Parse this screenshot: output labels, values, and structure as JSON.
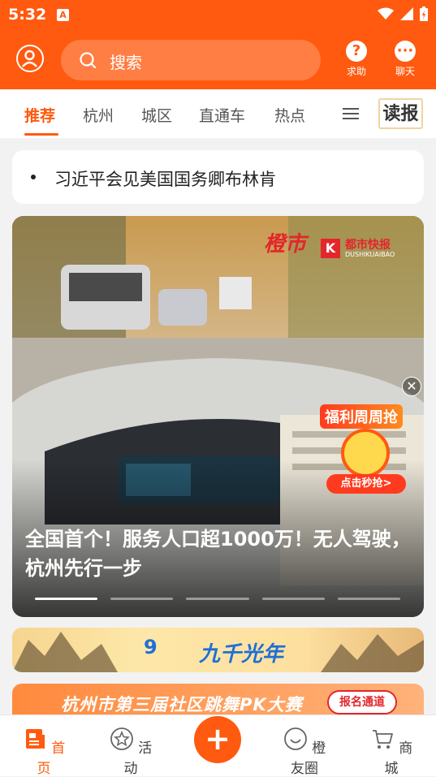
{
  "status": {
    "time": "5:32",
    "notif_letter": "A"
  },
  "header": {
    "search_placeholder": "搜索",
    "help_label": "求助",
    "chat_label": "聊天"
  },
  "tabs": [
    {
      "label": "推荐"
    },
    {
      "label": "杭州"
    },
    {
      "label": "城区"
    },
    {
      "label": "直通车"
    },
    {
      "label": "热点"
    }
  ],
  "dubao": "读报",
  "top_news": "习近平会见美国国务卿布林肯",
  "hero": {
    "brand_script": "橙市",
    "brand_name": "都市快报",
    "brand_sub": "DUSHIKUAIBAO",
    "title": "全国首个！服务人口超1000万！无人驾驶，杭州先行一步",
    "promo_title": "福利周周抢",
    "promo_button": "点击秒抢>",
    "close": "✕",
    "slide_count": 5,
    "active_slide": 1
  },
  "banner1": {
    "logo": "9",
    "text": "九千光年"
  },
  "banner2": {
    "text": "杭州市第三届社区跳舞PK大赛",
    "button": "报名通道"
  },
  "bottom_nav": [
    {
      "label": "首页"
    },
    {
      "label": "活动"
    },
    {
      "label": "橙友圈"
    },
    {
      "label": "商城"
    }
  ],
  "fab": "+",
  "colors": {
    "accent": "#ff5a0f"
  }
}
